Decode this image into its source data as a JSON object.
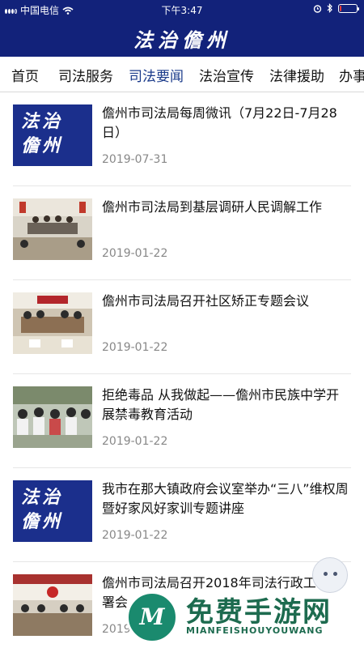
{
  "status_bar": {
    "carrier": "中国电信",
    "time": "下午3:47",
    "battery_level": 0.1
  },
  "header": {
    "logo_text": "法治儋州"
  },
  "nav": {
    "tabs": [
      {
        "label": "首页",
        "active": false
      },
      {
        "label": "司法服务",
        "active": false
      },
      {
        "label": "司法要闻",
        "active": true
      },
      {
        "label": "法治宣传",
        "active": false
      },
      {
        "label": "法律援助",
        "active": false
      },
      {
        "label": "办事",
        "active": false
      }
    ]
  },
  "news": {
    "items": [
      {
        "title": "儋州市司法局每周微讯（7月22日-7月28日）",
        "date": "2019-07-31",
        "thumb": "logo",
        "thumb_text": "法治儋州"
      },
      {
        "title": "儋州市司法局到基层调研人民调解工作",
        "date": "2019-01-22",
        "thumb": "photo"
      },
      {
        "title": "儋州市司法局召开社区矫正专题会议",
        "date": "2019-01-22",
        "thumb": "photo"
      },
      {
        "title": "拒绝毒品 从我做起——儋州市民族中学开展禁毒教育活动",
        "date": "2019-01-22",
        "thumb": "photo"
      },
      {
        "title": "我市在那大镇政府会议室举办“三八”维权周暨好家风好家训专题讲座",
        "date": "2019-01-22",
        "thumb": "logo",
        "thumb_text": "法治儋州"
      },
      {
        "title": "儋州市司法局召开2018年司法行政工作部署会",
        "date": "2019-01-22",
        "thumb": "photo"
      }
    ]
  },
  "watermark": {
    "title": "免费手游网",
    "subtitle": "MIANFEISHOUYOUWANG",
    "badge": "M"
  },
  "colors": {
    "header_bg": "#12227a",
    "active_tab": "#1a3a8a",
    "date_text": "#888888",
    "watermark_green": "#1d6b4f"
  }
}
